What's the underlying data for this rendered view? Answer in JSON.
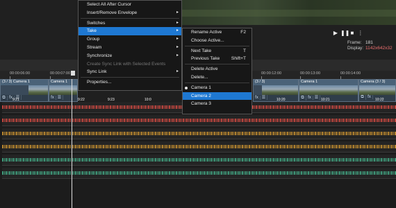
{
  "preview": {
    "transport": [
      "▶",
      "❚❚",
      "■",
      "⋮"
    ],
    "frame_label": "Frame:",
    "frame_value": "181",
    "display_label": "Display:",
    "display_value": "1142x642x32"
  },
  "ruler": {
    "ticks": [
      "00:00:06:00",
      "00:00:07:00",
      "00:00:12:00",
      "00:00:13:00",
      "00:00:14:00"
    ]
  },
  "video_events": [
    {
      "label": "Camera 1",
      "count": "(3 / 3)",
      "timecode": "9:21"
    },
    {
      "label": "Camera 1",
      "count": "",
      "timecode": "9:22"
    },
    {
      "label": "",
      "count": "",
      "timecode": "9:23"
    },
    {
      "label": "",
      "count": "",
      "timecode": "10:0"
    },
    {
      "label": "",
      "count": "",
      "timecode": "10:11"
    },
    {
      "label": "Camera 1",
      "count": "(3 / 3)",
      "timecode": "10:20"
    },
    {
      "label": "Camera 1",
      "count": "",
      "timecode": "10:21"
    },
    {
      "label": "Camera",
      "count": "(3 / 3)",
      "timecode": "10:22"
    }
  ],
  "event_buttons": {
    "fx": "fx",
    "crop": "⧉",
    "menu": "☰"
  },
  "audio_colors": [
    "#c0463f",
    "#c0463f",
    "#b8862e",
    "#b8862e",
    "#3f9a7a",
    "#3f9a7a"
  ],
  "context_menu": {
    "items": [
      {
        "label": "Select All After Cursor",
        "underline": "",
        "shortcut": "",
        "arrow": false,
        "disabled": false
      },
      {
        "label": "Insert/Remove Envelope",
        "underline": "Envelope",
        "shortcut": "",
        "arrow": true,
        "disabled": false
      },
      {
        "sep": true
      },
      {
        "label": "Switches",
        "underline": "",
        "shortcut": "",
        "arrow": true,
        "disabled": false
      },
      {
        "label": "Take",
        "underline": "",
        "shortcut": "",
        "arrow": true,
        "disabled": false,
        "highlight": true
      },
      {
        "label": "Group",
        "underline": "",
        "shortcut": "",
        "arrow": true,
        "disabled": false
      },
      {
        "label": "Stream",
        "underline": "",
        "shortcut": "",
        "arrow": true,
        "disabled": false
      },
      {
        "label": "Synchronize",
        "underline": "",
        "shortcut": "",
        "arrow": true,
        "disabled": false
      },
      {
        "label": "Create Sync Link with Selected Events",
        "underline": "",
        "shortcut": "",
        "arrow": false,
        "disabled": true
      },
      {
        "label": "Sync Link",
        "underline": "",
        "shortcut": "",
        "arrow": true,
        "disabled": false
      },
      {
        "sep": true
      },
      {
        "label": "Properties...",
        "underline": "",
        "shortcut": "",
        "arrow": false,
        "disabled": false
      }
    ]
  },
  "take_menu": {
    "items": [
      {
        "label": "Rename Active",
        "shortcut": "F2"
      },
      {
        "label": "Choose Active...",
        "shortcut": ""
      },
      {
        "sep": true
      },
      {
        "label": "Next Take",
        "shortcut": "T"
      },
      {
        "label": "Previous Take",
        "shortcut": "Shift+T"
      },
      {
        "sep": true
      },
      {
        "label": "Delete Active",
        "shortcut": ""
      },
      {
        "label": "Delete...",
        "shortcut": ""
      },
      {
        "sep": true
      },
      {
        "label": "Camera 1",
        "shortcut": "",
        "bullet": true
      },
      {
        "label": "Camera 2",
        "shortcut": "",
        "highlight": true
      },
      {
        "label": "Camera 3",
        "shortcut": ""
      }
    ]
  }
}
